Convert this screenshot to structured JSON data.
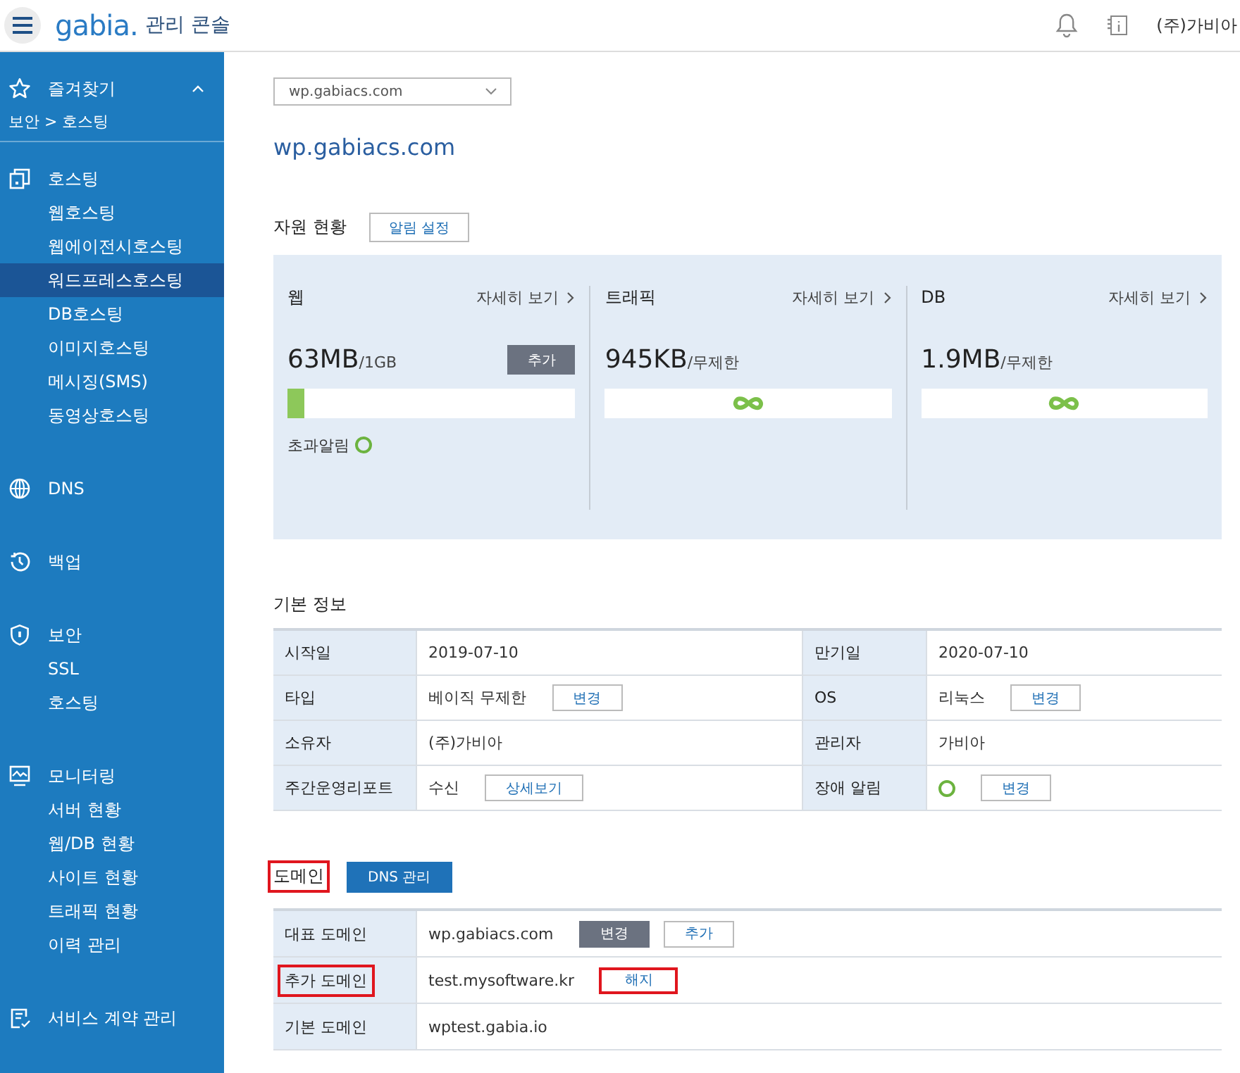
{
  "header": {
    "logo": "gabia.",
    "app_name": "관리 콘솔",
    "user": "(주)가비아"
  },
  "sidebar": {
    "favorites": {
      "label": "즐겨찾기",
      "expanded": true,
      "items": [
        "보안 > 호스팅"
      ]
    },
    "menu": [
      {
        "label": "호스팅",
        "children": [
          {
            "label": "웹호스팅",
            "selected": false
          },
          {
            "label": "웹에이전시호스팅",
            "selected": false
          },
          {
            "label": "워드프레스호스팅",
            "selected": true
          },
          {
            "label": "DB호스팅",
            "selected": false
          },
          {
            "label": "이미지호스팅",
            "selected": false
          },
          {
            "label": "메시징(SMS)",
            "selected": false
          },
          {
            "label": "동영상호스팅",
            "selected": false
          }
        ]
      },
      {
        "label": "DNS"
      },
      {
        "label": "백업"
      },
      {
        "label": "보안",
        "children": [
          {
            "label": "SSL",
            "selected": false
          },
          {
            "label": "호스팅",
            "selected": false
          }
        ]
      },
      {
        "label": "모니터링",
        "children": [
          {
            "label": "서버 현황",
            "selected": false
          },
          {
            "label": "웹/DB 현황",
            "selected": false
          },
          {
            "label": "사이트 현황",
            "selected": false
          },
          {
            "label": "트래픽 현황",
            "selected": false
          },
          {
            "label": "이력 관리",
            "selected": false
          }
        ]
      },
      {
        "label": "서비스 계약 관리"
      }
    ]
  },
  "site_select": {
    "value": "wp.gabiacs.com"
  },
  "site_title": "wp.gabiacs.com",
  "resources": {
    "title": "자원 현황",
    "button": "알림 설정",
    "panels": [
      {
        "kind": "metered",
        "title": "웹",
        "detail_link": "자세히 보기",
        "usage": "63MB",
        "limit": "/1GB",
        "level": 0.06,
        "add_button": "추가",
        "alert_label": "초과알림",
        "alert_enabled": true
      },
      {
        "kind": "unlimited",
        "title": "트래픽",
        "detail_link": "자세히 보기",
        "usage": "945KB",
        "limit": "/무제한"
      },
      {
        "kind": "unlimited",
        "title": "DB",
        "detail_link": "자세히 보기",
        "usage": "1.9MB",
        "limit": "/무제한"
      }
    ]
  },
  "basic_info": {
    "title": "기본 정보",
    "rows": [
      {
        "cells": [
          {
            "label": "시작일",
            "value": "2019-07-10"
          },
          {
            "label": "만기일",
            "value": "2020-07-10"
          }
        ]
      },
      {
        "cells": [
          {
            "label": "타입",
            "value": "베이직 무제한",
            "button": "변경"
          },
          {
            "label": "OS",
            "value": "리눅스",
            "button": "변경"
          }
        ]
      },
      {
        "cells": [
          {
            "label": "소유자",
            "value": "(주)가비아"
          },
          {
            "label": "관리자",
            "value": "가비아"
          }
        ]
      },
      {
        "cells": [
          {
            "label": "주간운영리포트",
            "value": "수신",
            "button": "상세보기"
          },
          {
            "label": "장애 알림",
            "alert_enabled": true,
            "button": "변경"
          }
        ]
      }
    ]
  },
  "domain": {
    "title": "도메인",
    "title_highlighted": true,
    "button": "DNS 관리",
    "rows": [
      {
        "label": "대표 도메인",
        "label_highlighted": false,
        "value": "wp.gabiacs.com",
        "buttons": [
          {
            "label": "변경",
            "kind": "filled",
            "highlighted": false
          },
          {
            "label": "추가",
            "kind": "outline",
            "highlighted": false
          }
        ]
      },
      {
        "label": "추가 도메인",
        "label_highlighted": true,
        "value": "test.mysoftware.kr",
        "buttons": [
          {
            "label": "해지",
            "kind": "outline",
            "highlighted": true
          }
        ]
      },
      {
        "label": "기본 도메인",
        "label_highlighted": false,
        "value": "wptest.gabia.io"
      }
    ]
  }
}
